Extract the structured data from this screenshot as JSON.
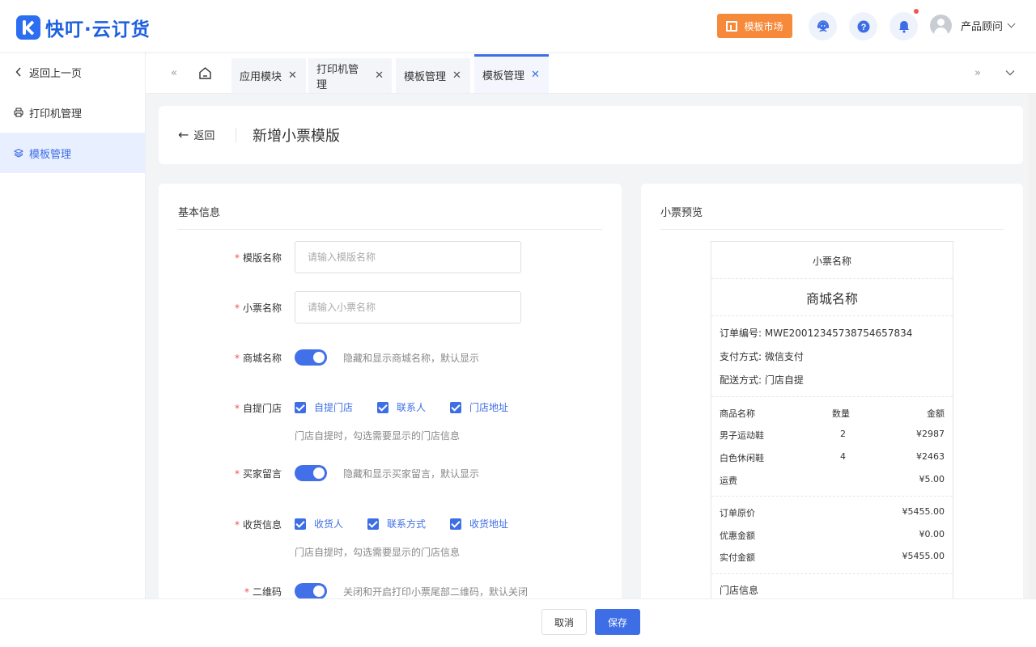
{
  "header": {
    "brand": "快叮·云订货",
    "template_market": "模板市场",
    "user_name": "产品顾问",
    "icons": [
      "service-icon",
      "help-icon",
      "bell-icon"
    ],
    "accent_color": "#3e6ee5",
    "market_color": "#f78a3a"
  },
  "sidebar": {
    "items": [
      {
        "label": "返回上一页",
        "icon": "chevron-left-icon"
      },
      {
        "label": "打印机管理",
        "icon": "printer-icon"
      },
      {
        "label": "模板管理",
        "icon": "layers-icon",
        "active": true
      }
    ]
  },
  "tabs": [
    {
      "label": "应用模块"
    },
    {
      "label": "打印机管理"
    },
    {
      "label": "模板管理"
    },
    {
      "label": "模板管理",
      "active": true
    }
  ],
  "page": {
    "back_label": "返回",
    "title": "新增小票模版"
  },
  "form": {
    "section_title": "基本信息",
    "template_name": {
      "label": "模版名称",
      "placeholder": "请输入模版名称"
    },
    "receipt_name": {
      "label": "小票名称",
      "placeholder": "请输入小票名称"
    },
    "mall_name": {
      "label": "商城名称",
      "hint": "隐藏和显示商城名称，默认显示",
      "on": true
    },
    "pickup_store": {
      "label": "自提门店",
      "options": [
        "自提门店",
        "联系人",
        "门店地址"
      ],
      "hint": "门店自提时，勾选需要显示的门店信息"
    },
    "buyer_message": {
      "label": "买家留言",
      "hint": "隐藏和显示买家留言，默认显示",
      "on": true
    },
    "shipping_info": {
      "label": "收货信息",
      "options": [
        "收货人",
        "联系方式",
        "收货地址"
      ],
      "hint": "门店自提时，勾选需要显示的门店信息"
    },
    "qrcode": {
      "label": "二维码",
      "hint": "关闭和开启打印小票尾部二维码，默认关闭",
      "on": true
    }
  },
  "preview": {
    "section_title": "小票预览",
    "receipt_name": "小票名称",
    "mall_name": "商城名称",
    "order_no": "订单编号: MWE20012345738754657834",
    "payment": "支付方式: 微信支付",
    "delivery": "配送方式: 门店自提",
    "table_headers": [
      "商品名称",
      "数量",
      "金额"
    ],
    "items": [
      {
        "name": "男子运动鞋",
        "qty": "2",
        "amount": "¥2987"
      },
      {
        "name": "白色休闲鞋",
        "qty": "4",
        "amount": "¥2463"
      },
      {
        "name": "运费",
        "qty": "",
        "amount": "¥5.00"
      }
    ],
    "summary": [
      {
        "label": "订单原价",
        "value": "¥5455.00"
      },
      {
        "label": "优惠金额",
        "value": "¥0.00"
      },
      {
        "label": "实付金额",
        "value": "¥5455.00"
      }
    ],
    "store_info": "门店信息"
  },
  "footer": {
    "cancel": "取消",
    "save": "保存"
  }
}
